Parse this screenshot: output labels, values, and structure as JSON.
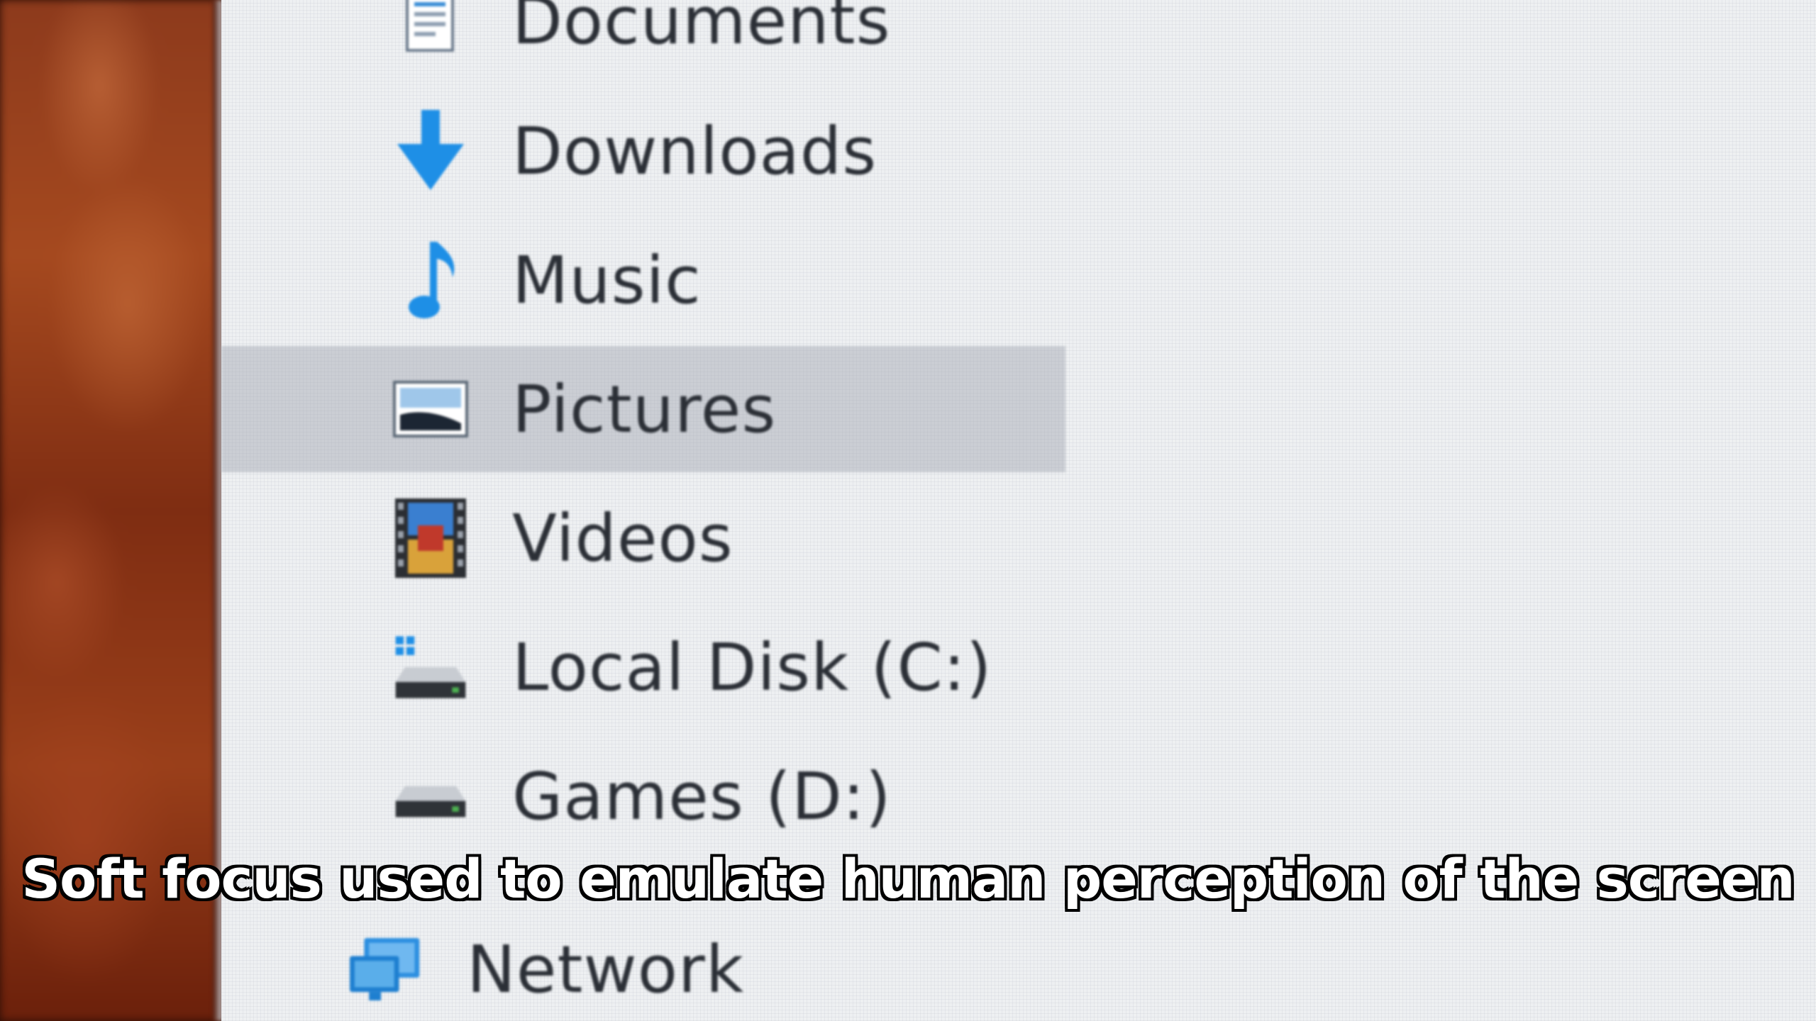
{
  "navigation_pane": {
    "items": [
      {
        "label": "Documents",
        "icon": "documents-icon",
        "selected": false
      },
      {
        "label": "Downloads",
        "icon": "downloads-icon",
        "selected": false
      },
      {
        "label": "Music",
        "icon": "music-icon",
        "selected": false
      },
      {
        "label": "Pictures",
        "icon": "pictures-icon",
        "selected": true
      },
      {
        "label": "Videos",
        "icon": "videos-icon",
        "selected": false
      },
      {
        "label": "Local Disk (C:)",
        "icon": "local-disk-icon",
        "selected": false
      },
      {
        "label": "Games (D:)",
        "icon": "drive-icon",
        "selected": false
      },
      {
        "label": "Network",
        "icon": "network-icon",
        "selected": false
      }
    ]
  },
  "caption": "Soft focus used to emulate human perception of the screen",
  "colors": {
    "selection": "#a0a5af",
    "pane_background": "#eef0f2",
    "accent_blue": "#1e8fe6",
    "wallpaper": "#8d3a1c"
  }
}
